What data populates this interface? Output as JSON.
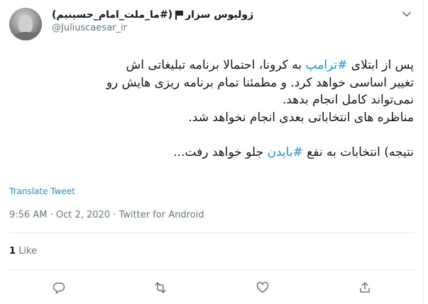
{
  "author": {
    "name": "ژولیوس سزار",
    "name_tag": "(#ما_ملت_امام_حسینیم)",
    "handle": "@Juliuscaesar_ir"
  },
  "tweet": {
    "lines": [
      {
        "before": "پس از ابتلای ",
        "tag": "#ترامپ",
        "after": " به کرونا، احتمالا برنامه تبلیغاتی اش"
      },
      {
        "before": "تغییر اساسی خواهد کرد. و مطمئنا تمام برنامه ریزی هایش رو",
        "tag": "",
        "after": ""
      },
      {
        "before": "نمی‌تواند کامل انجام بدهد.",
        "tag": "",
        "after": ""
      },
      {
        "before": "مناظره های انتخاباتی بعدی انجام نخواهد شد.",
        "tag": "",
        "after": ""
      },
      {
        "before": "",
        "tag": "",
        "after": ""
      },
      {
        "before": "نتیجه) انتخابات به نفع ",
        "tag": "#بایدن",
        "after": " جلو خواهد رفت..."
      }
    ],
    "translate_label": "Translate Tweet",
    "time": "9:56 AM",
    "date": "Oct 2, 2020",
    "source": "Twitter for Android",
    "separator": "·"
  },
  "stats": {
    "likes_count": "1",
    "likes_label": "Like"
  },
  "icons": {
    "reply": "reply-icon",
    "retweet": "retweet-icon",
    "like": "heart-icon",
    "share": "share-icon",
    "menu": "chevron-down-icon"
  },
  "colors": {
    "link": "#1b95e0",
    "muted": "#657786",
    "text": "#14171a",
    "divider": "#e6ecf0"
  }
}
